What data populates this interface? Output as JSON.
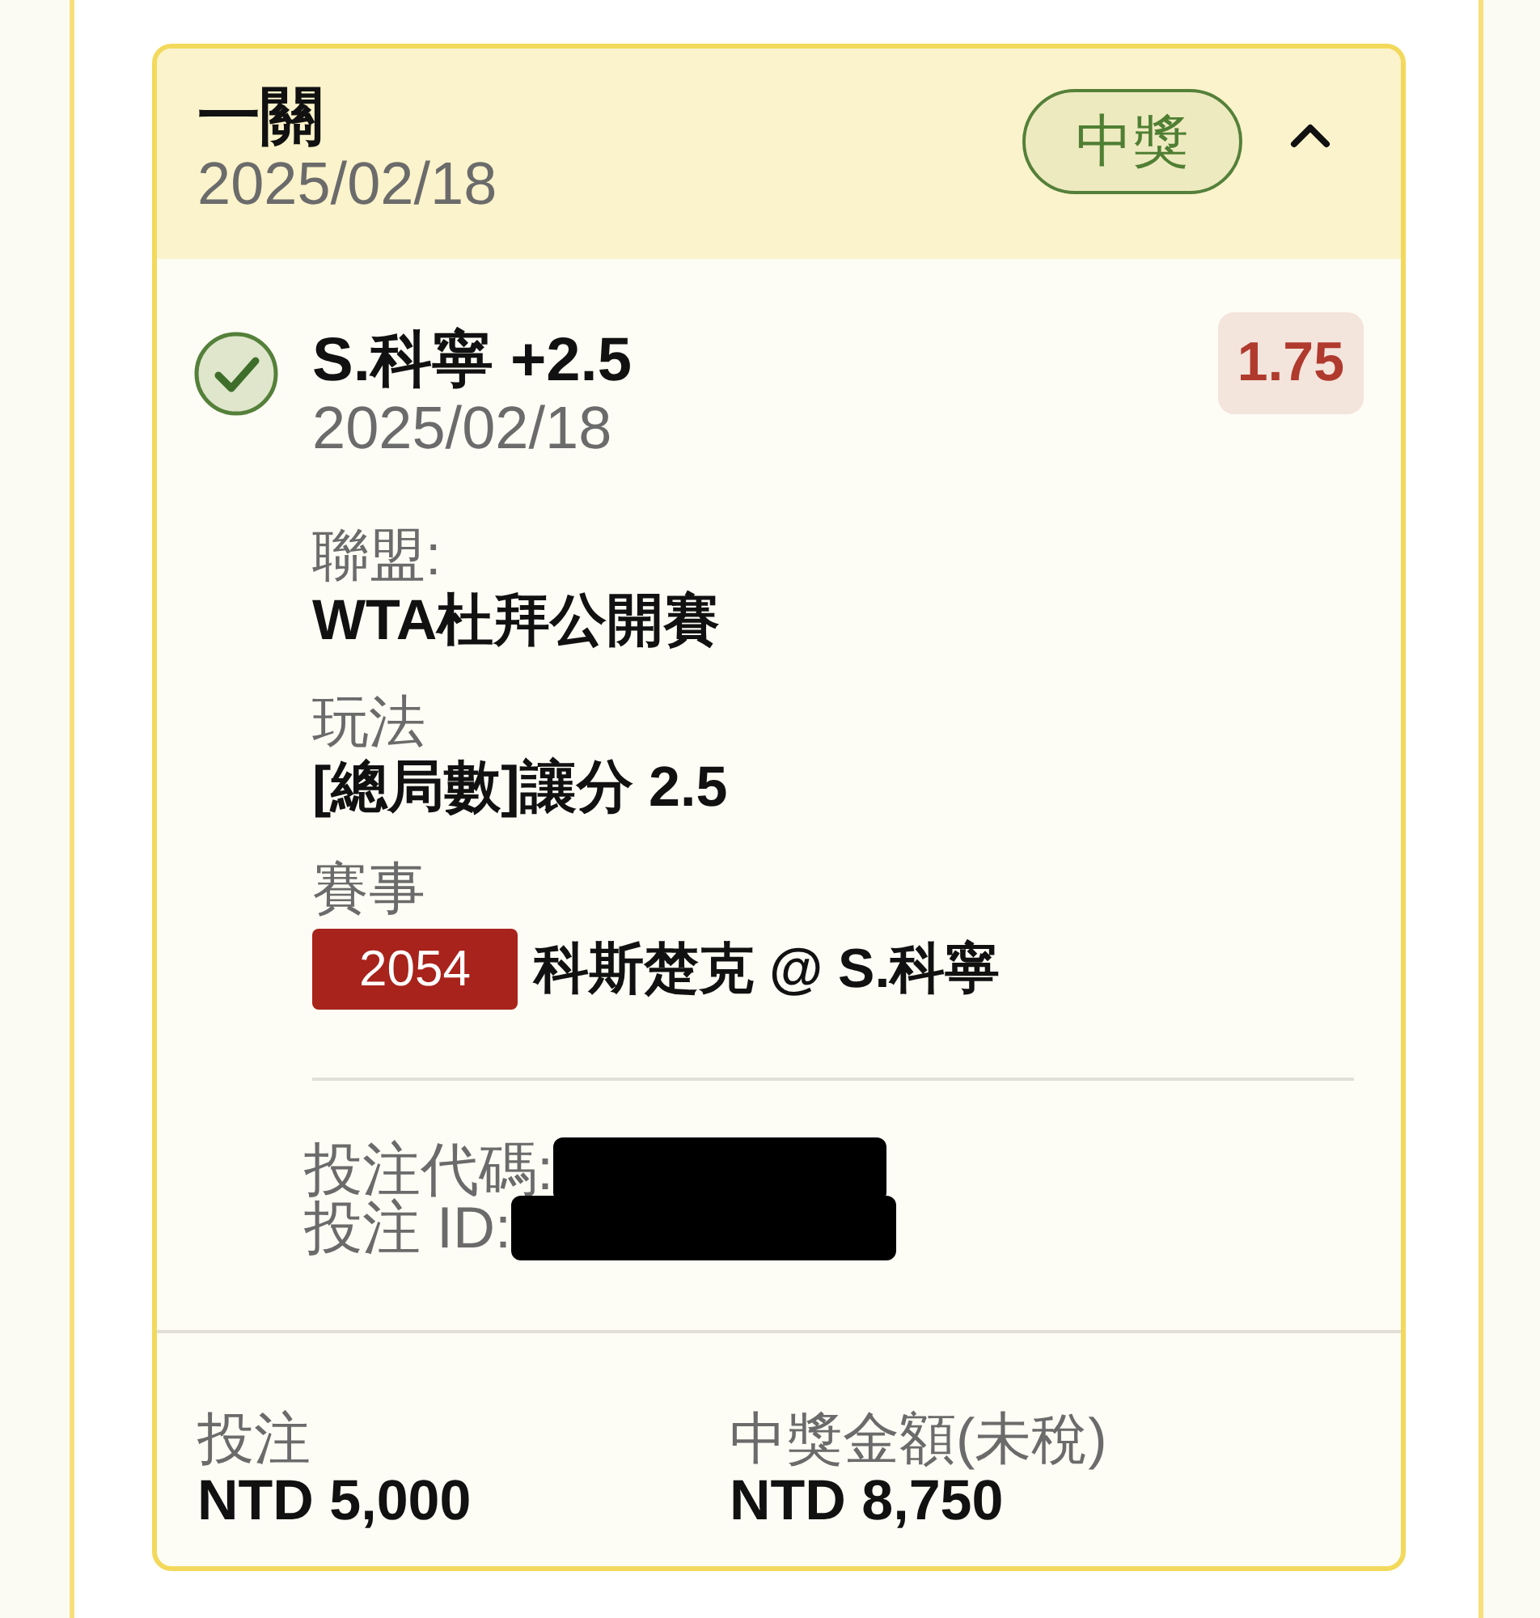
{
  "card": {
    "title": "一關",
    "date": "2025/02/18",
    "badge": "中獎",
    "expanded": true
  },
  "selection": {
    "checked": true,
    "title": "S.科寧 +2.5",
    "date": "2025/02/18",
    "odds": "1.75"
  },
  "details": [
    {
      "label": "聯盟:",
      "value": "WTA杜拜公開賽"
    },
    {
      "label": "玩法",
      "value": "[總局數]讓分 2.5"
    }
  ],
  "event": {
    "label": "賽事",
    "match_number": "2054",
    "teams": "科斯楚克 @ S.科寧"
  },
  "codes": [
    {
      "label": "投注代碼:",
      "redacted": true
    },
    {
      "label": "投注 ID:",
      "redacted": true
    }
  ],
  "totals": [
    {
      "label": "投注",
      "value": "NTD 5,000"
    },
    {
      "label": "中獎金額(未稅)",
      "value": "NTD 8,750"
    }
  ]
}
